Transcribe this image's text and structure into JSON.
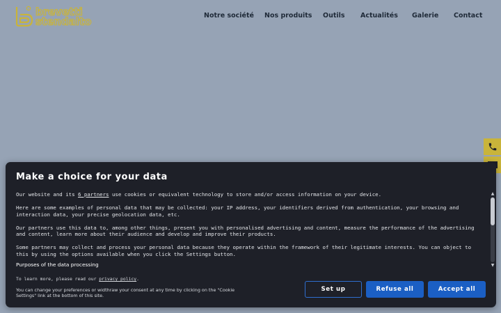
{
  "header": {
    "logo_text_top": "brevetti",
    "logo_text_bottom": "stendalto",
    "nav": [
      {
        "label": "Notre société"
      },
      {
        "label": "Nos produits"
      },
      {
        "label": "Outils"
      },
      {
        "label": "Actualités"
      },
      {
        "label": "Galerie"
      },
      {
        "label": "Contact"
      }
    ]
  },
  "side_tabs": [
    {
      "icon": "phone-icon"
    },
    {
      "icon": "mail-icon"
    }
  ],
  "cookie_modal": {
    "title": "Make a choice for your data",
    "p1_before": "Our website and its ",
    "p1_link": "6 partners",
    "p1_after": " use cookies or equivalent technology to store and/or access information on your device.",
    "p2": "Here are some examples of personal data that may be collected: your IP address, your identifiers derived from authentication, your browsing and interaction data, your precise geolocation data, etc.",
    "p3": "Our partners use this data to, among other things, present you with personalised advertising and content, measure the performance of the advertising and content, learn more about their audience and develop and improve their products.",
    "p4": "Some partners may collect and process your personal data because they operate within the framework of their legitimate interests. You can object to this by using the options available when you click the Settings button.",
    "purposes_label": "Purposes of the data processing",
    "learn_more_before": "To learn more, please read our ",
    "learn_more_link": "privacy policy",
    "learn_more_after": ".",
    "change_note": "You can change your preferences or widthraw your consent at any time by clicking on the \"Cookie Settings\" link at the bottom of this site.",
    "buttons": {
      "setup": "Set up",
      "refuse": "Refuse all",
      "accept": "Accept all"
    }
  },
  "colors": {
    "page_background": "#96a3b5",
    "brand_gold": "#c9b43a",
    "modal_background": "#1e2028",
    "button_blue": "#1b5fc4"
  }
}
